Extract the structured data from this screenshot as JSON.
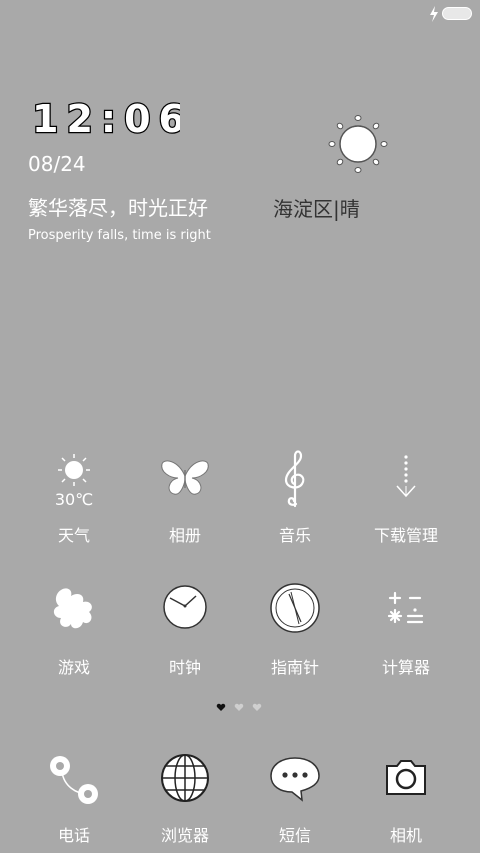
{
  "clock": {
    "time": "12:06"
  },
  "date": "08/24",
  "quote": {
    "cn": "繁华落尽，时光正好",
    "en": "Prosperity falls, time is right"
  },
  "weather": {
    "location": "海淀区|晴",
    "temp": "30℃"
  },
  "apps_row1": [
    {
      "label": "天气",
      "icon": "weather-sun-icon"
    },
    {
      "label": "相册",
      "icon": "butterfly-icon"
    },
    {
      "label": "音乐",
      "icon": "treble-clef-icon"
    },
    {
      "label": "下载管理",
      "icon": "download-arrow-icon"
    }
  ],
  "apps_row2": [
    {
      "label": "游戏",
      "icon": "puzzle-icon"
    },
    {
      "label": "时钟",
      "icon": "clock-icon"
    },
    {
      "label": "指南针",
      "icon": "compass-icon"
    },
    {
      "label": "计算器",
      "icon": "calculator-icon"
    }
  ],
  "page_indicator": {
    "count": 3,
    "active": 0
  },
  "dock": [
    {
      "label": "电话",
      "icon": "phone-icon"
    },
    {
      "label": "浏览器",
      "icon": "globe-icon"
    },
    {
      "label": "短信",
      "icon": "message-icon"
    },
    {
      "label": "相机",
      "icon": "camera-icon"
    }
  ]
}
